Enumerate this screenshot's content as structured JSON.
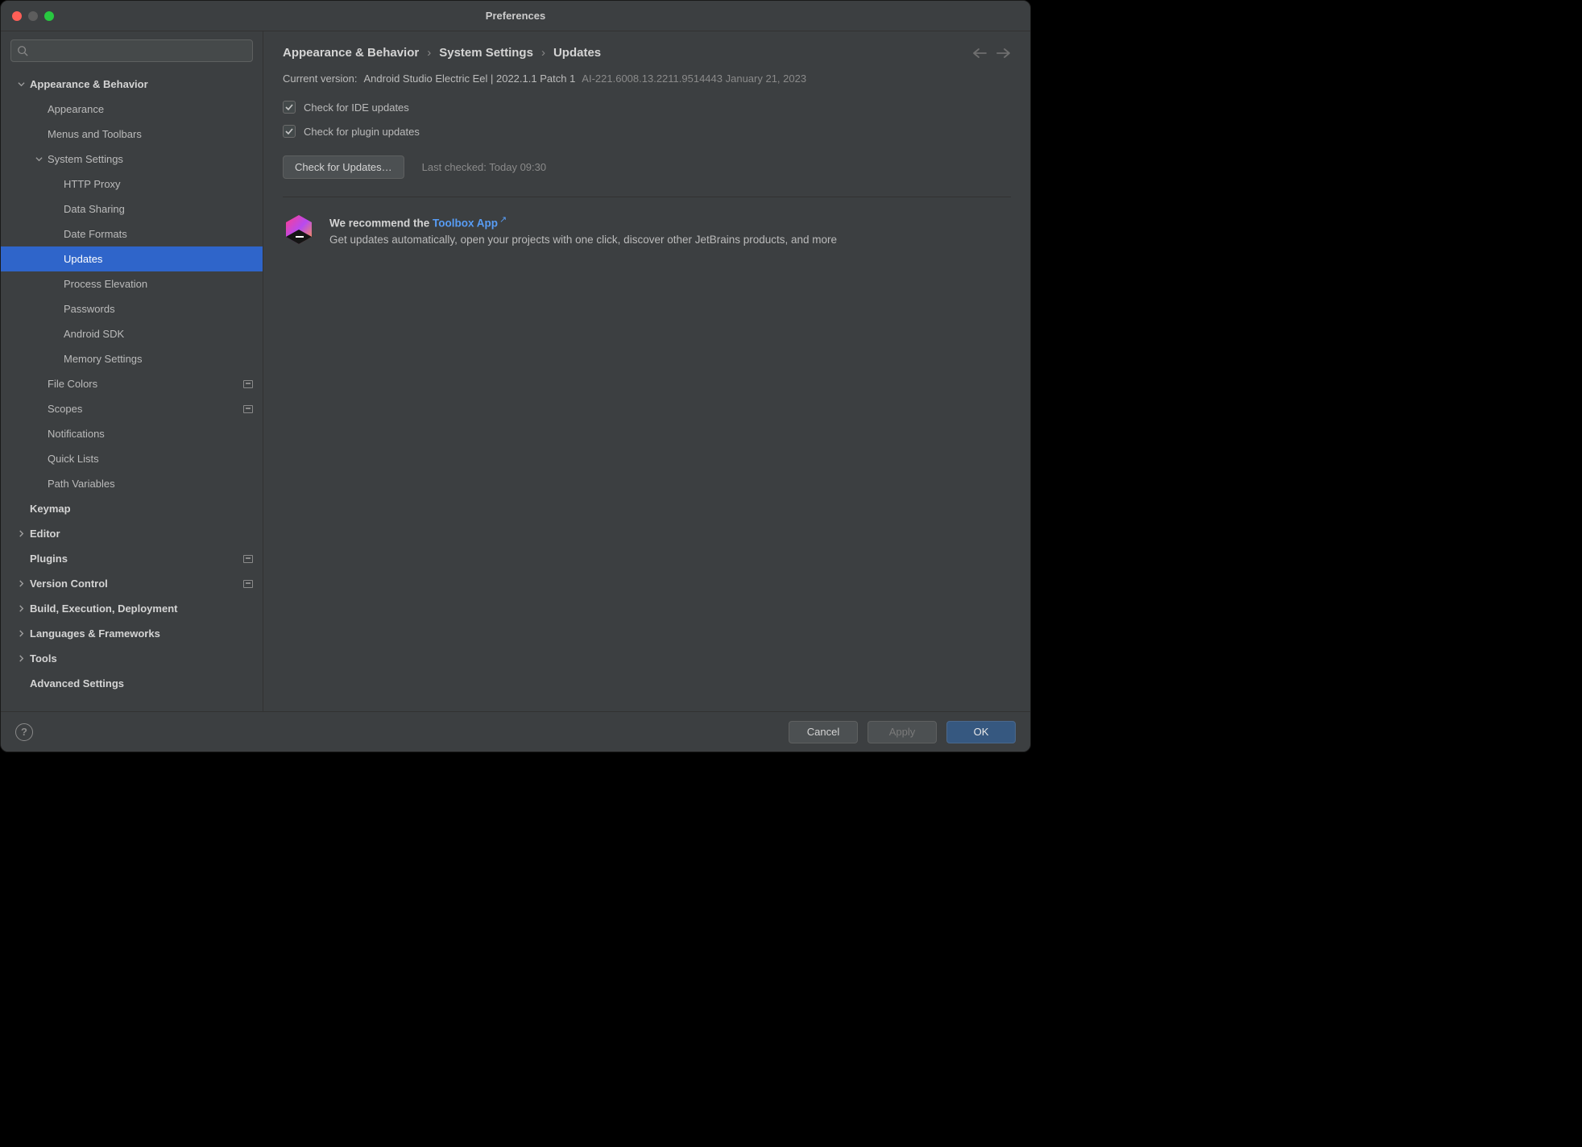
{
  "window": {
    "title": "Preferences"
  },
  "search": {
    "placeholder": ""
  },
  "sidebar": {
    "items": [
      {
        "label": "Appearance & Behavior",
        "indent": 0,
        "bold": true,
        "chev": "down"
      },
      {
        "label": "Appearance",
        "indent": 1
      },
      {
        "label": "Menus and Toolbars",
        "indent": 1
      },
      {
        "label": "System Settings",
        "indent": 1,
        "chev": "down"
      },
      {
        "label": "HTTP Proxy",
        "indent": 2
      },
      {
        "label": "Data Sharing",
        "indent": 2
      },
      {
        "label": "Date Formats",
        "indent": 2
      },
      {
        "label": "Updates",
        "indent": 2,
        "selected": true
      },
      {
        "label": "Process Elevation",
        "indent": 2
      },
      {
        "label": "Passwords",
        "indent": 2
      },
      {
        "label": "Android SDK",
        "indent": 2
      },
      {
        "label": "Memory Settings",
        "indent": 2
      },
      {
        "label": "File Colors",
        "indent": 1,
        "badge": true
      },
      {
        "label": "Scopes",
        "indent": 1,
        "badge": true
      },
      {
        "label": "Notifications",
        "indent": 1
      },
      {
        "label": "Quick Lists",
        "indent": 1
      },
      {
        "label": "Path Variables",
        "indent": 1
      },
      {
        "label": "Keymap",
        "indent": 0,
        "bold": true
      },
      {
        "label": "Editor",
        "indent": 0,
        "bold": true,
        "chev": "right"
      },
      {
        "label": "Plugins",
        "indent": 0,
        "bold": true,
        "badge": true
      },
      {
        "label": "Version Control",
        "indent": 0,
        "bold": true,
        "chev": "right",
        "badge": true
      },
      {
        "label": "Build, Execution, Deployment",
        "indent": 0,
        "bold": true,
        "chev": "right"
      },
      {
        "label": "Languages & Frameworks",
        "indent": 0,
        "bold": true,
        "chev": "right"
      },
      {
        "label": "Tools",
        "indent": 0,
        "bold": true,
        "chev": "right"
      },
      {
        "label": "Advanced Settings",
        "indent": 0,
        "bold": true
      }
    ]
  },
  "breadcrumb": {
    "a": "Appearance & Behavior",
    "b": "System Settings",
    "c": "Updates"
  },
  "version": {
    "label": "Current version:",
    "value": "Android Studio Electric Eel | 2022.1.1 Patch 1",
    "build": "AI-221.6008.13.2211.9514443 January 21, 2023"
  },
  "checks": {
    "ide": "Check for IDE updates",
    "plugin": "Check for plugin updates"
  },
  "actions": {
    "check_btn": "Check for Updates…",
    "last_checked": "Last checked: Today 09:30"
  },
  "reco": {
    "lead": "We recommend the ",
    "link": "Toolbox App",
    "body": "Get updates automatically, open your projects with one click, discover other JetBrains products, and more"
  },
  "footer": {
    "help": "?",
    "cancel": "Cancel",
    "apply": "Apply",
    "ok": "OK"
  }
}
